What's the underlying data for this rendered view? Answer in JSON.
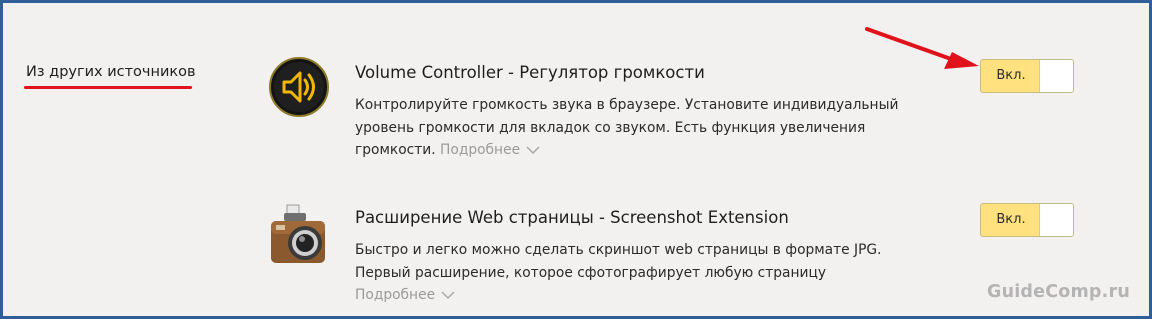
{
  "section": {
    "label": "Из других источников",
    "accent_color": "#e0121b"
  },
  "extensions": [
    {
      "icon": "speaker-icon",
      "title": "Volume Controller - Регулятор громкости",
      "desc_lines": [
        "Контролируйте громкость звука в браузере. Установите индивидуальный",
        "уровень громкости для вкладок со звуком. Есть функция увеличения",
        "громкости."
      ],
      "more": "Подробнее",
      "toggle": {
        "label": "Вкл.",
        "state": "on"
      }
    },
    {
      "icon": "camera-icon",
      "title": "Расширение Web страницы - Screenshot Extension",
      "desc_lines": [
        "Быстро и легко можно сделать скриншот web страницы в формате JPG.",
        "Первый расширение, которое сфотографирует любую страницу"
      ],
      "more": "Подробнее",
      "toggle": {
        "label": "Вкл.",
        "state": "on"
      }
    }
  ],
  "colors": {
    "frame_border": "#2f5e98",
    "panel_bg": "#f2f1f0",
    "toggle_bg": "#ffe27f",
    "arrow": "#e0121b"
  },
  "watermark": "GuideComp.ru"
}
